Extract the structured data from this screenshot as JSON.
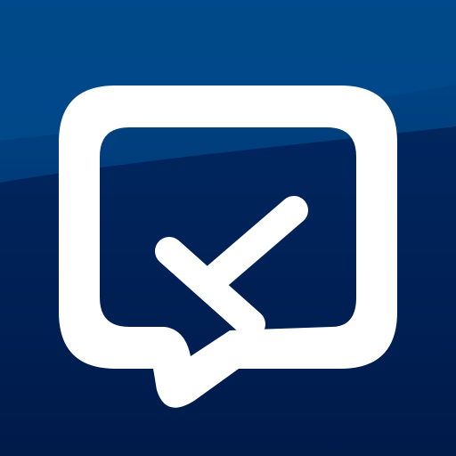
{
  "icon": {
    "name": "chat-checkmark-app-icon",
    "symbol": "speech-bubble-with-checkmark",
    "colors": {
      "background_dark": "#001a4a",
      "background_mid": "#00265f",
      "background_light": "#00498a",
      "glyph": "#ffffff"
    }
  }
}
